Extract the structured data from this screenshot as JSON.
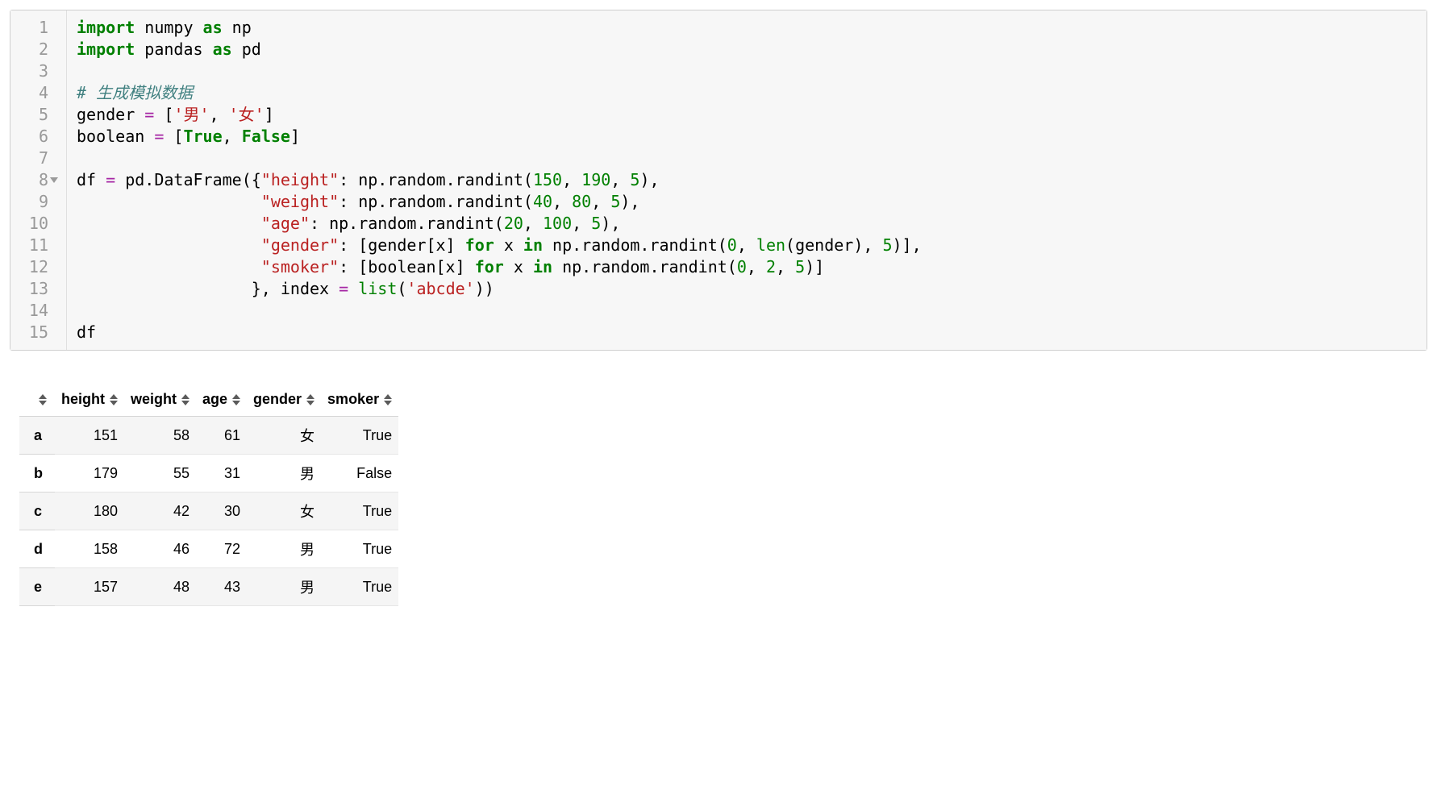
{
  "code": {
    "total_lines": 15,
    "fold_marker_line": 8,
    "lines": [
      [
        {
          "cls": "tok-kw",
          "t": "import"
        },
        {
          "cls": "tok-pl",
          "t": " numpy "
        },
        {
          "cls": "tok-kw",
          "t": "as"
        },
        {
          "cls": "tok-pl",
          "t": " np"
        }
      ],
      [
        {
          "cls": "tok-kw",
          "t": "import"
        },
        {
          "cls": "tok-pl",
          "t": " pandas "
        },
        {
          "cls": "tok-kw",
          "t": "as"
        },
        {
          "cls": "tok-pl",
          "t": " pd"
        }
      ],
      [],
      [
        {
          "cls": "tok-cm",
          "t": "# 生成模拟数据"
        }
      ],
      [
        {
          "cls": "tok-pl",
          "t": "gender "
        },
        {
          "cls": "tok-op",
          "t": "="
        },
        {
          "cls": "tok-pl",
          "t": " ["
        },
        {
          "cls": "tok-st",
          "t": "'男'"
        },
        {
          "cls": "tok-pl",
          "t": ", "
        },
        {
          "cls": "tok-st",
          "t": "'女'"
        },
        {
          "cls": "tok-pl",
          "t": "]"
        }
      ],
      [
        {
          "cls": "tok-pl",
          "t": "boolean "
        },
        {
          "cls": "tok-op",
          "t": "="
        },
        {
          "cls": "tok-pl",
          "t": " ["
        },
        {
          "cls": "tok-bl",
          "t": "True"
        },
        {
          "cls": "tok-pl",
          "t": ", "
        },
        {
          "cls": "tok-bl",
          "t": "False"
        },
        {
          "cls": "tok-pl",
          "t": "]"
        }
      ],
      [],
      [
        {
          "cls": "tok-pl",
          "t": "df "
        },
        {
          "cls": "tok-op",
          "t": "="
        },
        {
          "cls": "tok-pl",
          "t": " pd.DataFrame({"
        },
        {
          "cls": "tok-st",
          "t": "\"height\""
        },
        {
          "cls": "tok-pl",
          "t": ": np.random.randint("
        },
        {
          "cls": "tok-nm",
          "t": "150"
        },
        {
          "cls": "tok-pl",
          "t": ", "
        },
        {
          "cls": "tok-nm",
          "t": "190"
        },
        {
          "cls": "tok-pl",
          "t": ", "
        },
        {
          "cls": "tok-nm",
          "t": "5"
        },
        {
          "cls": "tok-pl",
          "t": "),"
        }
      ],
      [
        {
          "cls": "tok-pl",
          "t": "                   "
        },
        {
          "cls": "tok-st",
          "t": "\"weight\""
        },
        {
          "cls": "tok-pl",
          "t": ": np.random.randint("
        },
        {
          "cls": "tok-nm",
          "t": "40"
        },
        {
          "cls": "tok-pl",
          "t": ", "
        },
        {
          "cls": "tok-nm",
          "t": "80"
        },
        {
          "cls": "tok-pl",
          "t": ", "
        },
        {
          "cls": "tok-nm",
          "t": "5"
        },
        {
          "cls": "tok-pl",
          "t": "),"
        }
      ],
      [
        {
          "cls": "tok-pl",
          "t": "                   "
        },
        {
          "cls": "tok-st",
          "t": "\"age\""
        },
        {
          "cls": "tok-pl",
          "t": ": np.random.randint("
        },
        {
          "cls": "tok-nm",
          "t": "20"
        },
        {
          "cls": "tok-pl",
          "t": ", "
        },
        {
          "cls": "tok-nm",
          "t": "100"
        },
        {
          "cls": "tok-pl",
          "t": ", "
        },
        {
          "cls": "tok-nm",
          "t": "5"
        },
        {
          "cls": "tok-pl",
          "t": "),"
        }
      ],
      [
        {
          "cls": "tok-pl",
          "t": "                   "
        },
        {
          "cls": "tok-st",
          "t": "\"gender\""
        },
        {
          "cls": "tok-pl",
          "t": ": [gender[x] "
        },
        {
          "cls": "tok-kw",
          "t": "for"
        },
        {
          "cls": "tok-pl",
          "t": " x "
        },
        {
          "cls": "tok-kw",
          "t": "in"
        },
        {
          "cls": "tok-pl",
          "t": " np.random.randint("
        },
        {
          "cls": "tok-nm",
          "t": "0"
        },
        {
          "cls": "tok-pl",
          "t": ", "
        },
        {
          "cls": "tok-fn",
          "t": "len"
        },
        {
          "cls": "tok-pl",
          "t": "(gender), "
        },
        {
          "cls": "tok-nm",
          "t": "5"
        },
        {
          "cls": "tok-pl",
          "t": ")],"
        }
      ],
      [
        {
          "cls": "tok-pl",
          "t": "                   "
        },
        {
          "cls": "tok-st",
          "t": "\"smoker\""
        },
        {
          "cls": "tok-pl",
          "t": ": [boolean[x] "
        },
        {
          "cls": "tok-kw",
          "t": "for"
        },
        {
          "cls": "tok-pl",
          "t": " x "
        },
        {
          "cls": "tok-kw",
          "t": "in"
        },
        {
          "cls": "tok-pl",
          "t": " np.random.randint("
        },
        {
          "cls": "tok-nm",
          "t": "0"
        },
        {
          "cls": "tok-pl",
          "t": ", "
        },
        {
          "cls": "tok-nm",
          "t": "2"
        },
        {
          "cls": "tok-pl",
          "t": ", "
        },
        {
          "cls": "tok-nm",
          "t": "5"
        },
        {
          "cls": "tok-pl",
          "t": ")]"
        }
      ],
      [
        {
          "cls": "tok-pl",
          "t": "                  }, index "
        },
        {
          "cls": "tok-op",
          "t": "="
        },
        {
          "cls": "tok-pl",
          "t": " "
        },
        {
          "cls": "tok-fn",
          "t": "list"
        },
        {
          "cls": "tok-pl",
          "t": "("
        },
        {
          "cls": "tok-st",
          "t": "'abcde'"
        },
        {
          "cls": "tok-pl",
          "t": "))"
        }
      ],
      [],
      [
        {
          "cls": "tok-pl",
          "t": "df"
        }
      ]
    ]
  },
  "dataframe": {
    "columns": [
      "height",
      "weight",
      "age",
      "gender",
      "smoker"
    ],
    "index": [
      "a",
      "b",
      "c",
      "d",
      "e"
    ],
    "data": [
      {
        "height": "151",
        "weight": "58",
        "age": "61",
        "gender": "女",
        "smoker": "True"
      },
      {
        "height": "179",
        "weight": "55",
        "age": "31",
        "gender": "男",
        "smoker": "False"
      },
      {
        "height": "180",
        "weight": "42",
        "age": "30",
        "gender": "女",
        "smoker": "True"
      },
      {
        "height": "158",
        "weight": "46",
        "age": "72",
        "gender": "男",
        "smoker": "True"
      },
      {
        "height": "157",
        "weight": "48",
        "age": "43",
        "gender": "男",
        "smoker": "True"
      }
    ]
  }
}
